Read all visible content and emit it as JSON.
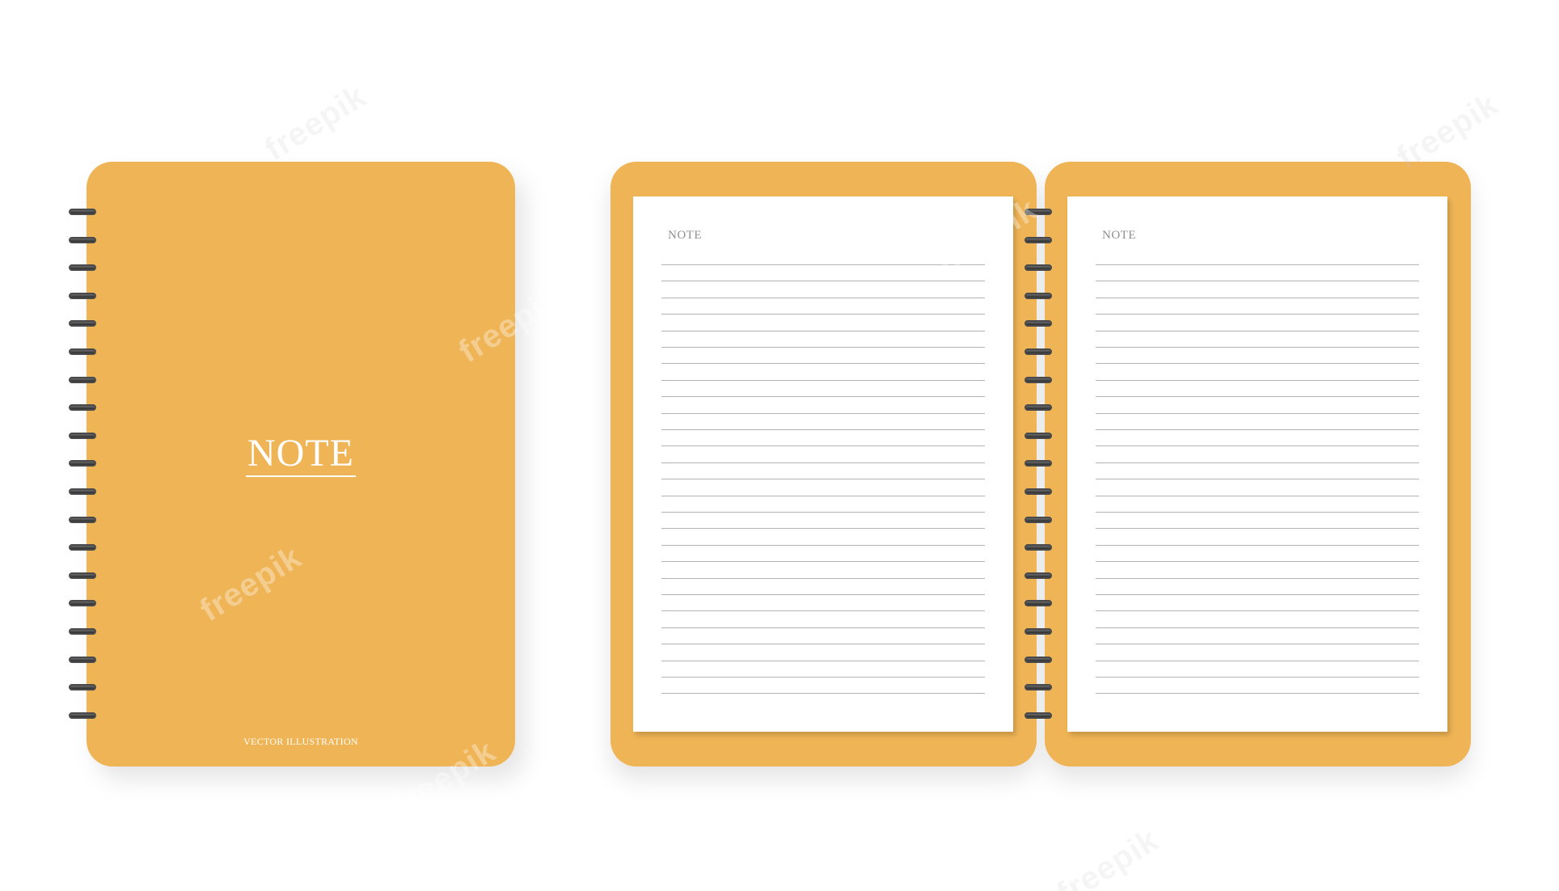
{
  "colors": {
    "cover": "#EFB455",
    "page": "#FFFFFF",
    "rule": "#B3B3B3",
    "page_title": "#8F8F8F",
    "spiral": "#4A4A4A"
  },
  "closed_notebook": {
    "title": "NOTE",
    "footer": "VECTOR ILLUSTRATION",
    "ring_count": 19
  },
  "open_notebook": {
    "ring_count": 19,
    "pages": [
      {
        "title": "NOTE",
        "rule_count": 27
      },
      {
        "title": "NOTE",
        "rule_count": 27
      }
    ]
  },
  "watermark": {
    "text": "freepik"
  },
  "icons": [
    "spiral-ring-icon",
    "freepik-logo-icon"
  ]
}
